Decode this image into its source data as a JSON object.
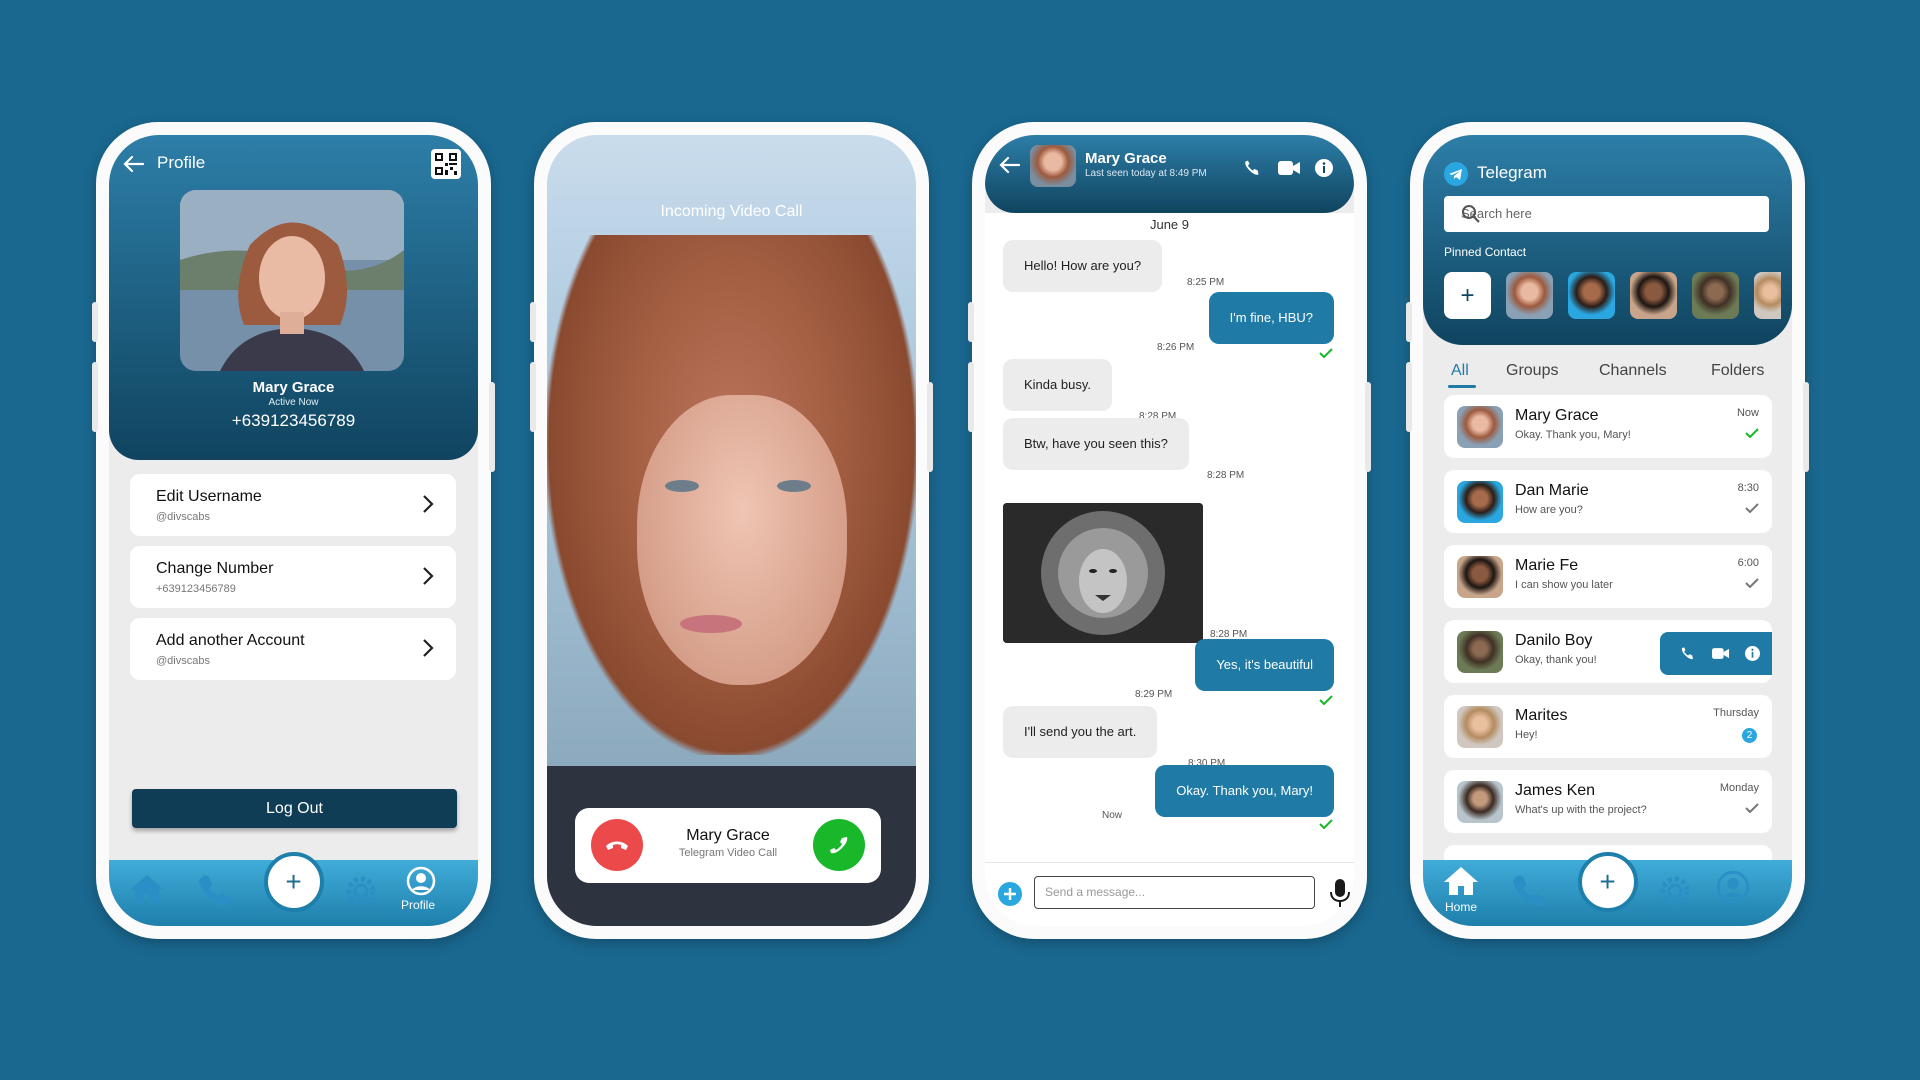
{
  "colors": {
    "background": "#1a6890",
    "header_dark": "#10445f",
    "accent": "#1f7aa5",
    "nav": "#3aa3d2",
    "accept": "#19b82a",
    "decline": "#ec4a4a"
  },
  "profile": {
    "title": "Profile",
    "name": "Mary Grace",
    "status": "Active Now",
    "phone": "+639123456789",
    "cards": [
      {
        "title": "Edit Username",
        "subtitle": "@divscabs"
      },
      {
        "title": "Change Number",
        "subtitle": "+639123456789"
      },
      {
        "title": "Add another Account",
        "subtitle": "@divscabs"
      }
    ],
    "logout": "Log Out",
    "nav_label": "Profile"
  },
  "call": {
    "title": "Incoming Video Call",
    "name": "Mary Grace",
    "subtitle": "Telegram Video Call"
  },
  "chat": {
    "name": "Mary Grace",
    "last_seen": "Last seen today at 8:49 PM",
    "date": "June 9",
    "messages": [
      {
        "text": "Hello! How are you?",
        "time": "8:25 PM",
        "dir": "in"
      },
      {
        "text": "I'm fine, HBU?",
        "time": "8:26 PM",
        "dir": "out"
      },
      {
        "text": "Kinda busy.",
        "time": "8:28 PM",
        "dir": "in"
      },
      {
        "text": "Btw, have you seen this?",
        "time": "8:28 PM",
        "dir": "in"
      },
      {
        "text": "",
        "time": "8:28 PM",
        "dir": "in",
        "type": "image"
      },
      {
        "text": "Yes, it's beautiful",
        "time": "8:29 PM",
        "dir": "out"
      },
      {
        "text": "I'll send you the art.",
        "time": "8:30 PM",
        "dir": "in"
      },
      {
        "text": "Okay. Thank you, Mary!",
        "time": "Now",
        "dir": "out"
      }
    ],
    "input_placeholder": "Send a message..."
  },
  "telegram": {
    "title": "Telegram",
    "search_placeholder": "Search here",
    "pinned_label": "Pinned Contact",
    "tabs": [
      "All",
      "Groups",
      "Channels",
      "Folders"
    ],
    "chats": [
      {
        "name": "Mary Grace",
        "message": "Okay. Thank you, Mary!",
        "time": "Now"
      },
      {
        "name": "Dan Marie",
        "message": "How are you?",
        "time": "8:30"
      },
      {
        "name": "Marie Fe",
        "message": "I can show you later",
        "time": "6:00"
      },
      {
        "name": "Danilo Boy",
        "message": "Okay, thank you!",
        "time": ""
      },
      {
        "name": "Marites",
        "message": "Hey!",
        "time": "Thursday",
        "unread": "2"
      },
      {
        "name": "James Ken",
        "message": "What's up with the project?",
        "time": "Monday"
      }
    ],
    "nav_label": "Home"
  }
}
